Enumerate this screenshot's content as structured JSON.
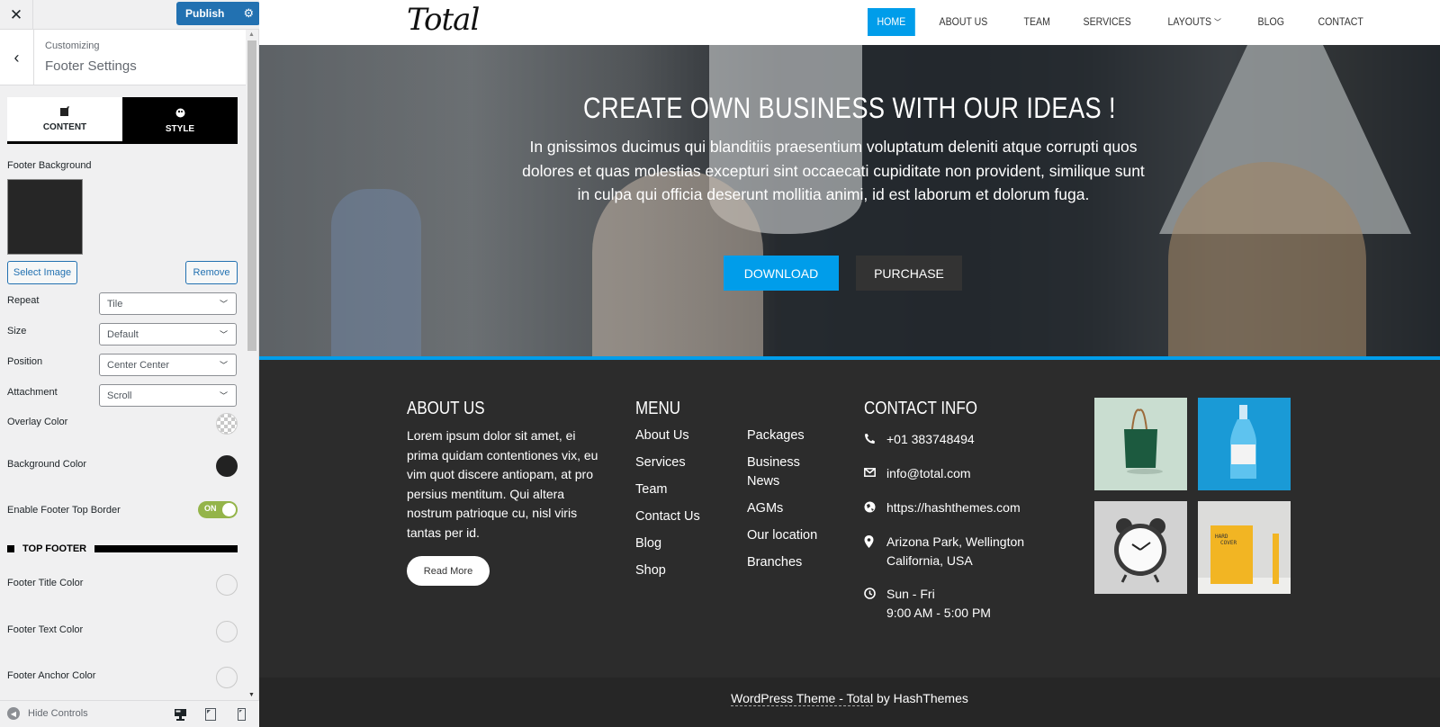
{
  "customizer": {
    "close_icon": "close-icon",
    "publish_label": "Publish",
    "settings_icon": "gear-icon",
    "back_icon": "chevron-left-icon",
    "breadcrumb_label": "Customizing",
    "section_title": "Footer Settings",
    "tabs": [
      {
        "label": "CONTENT",
        "icon": "edit-icon",
        "active": false
      },
      {
        "label": "STYLE",
        "icon": "palette-icon",
        "active": true
      }
    ],
    "footer_background": {
      "label": "Footer Background",
      "preview_color": "#262626",
      "select_image_label": "Select Image",
      "remove_label": "Remove"
    },
    "selects": [
      {
        "label": "Repeat",
        "value": "Tile"
      },
      {
        "label": "Size",
        "value": "Default"
      },
      {
        "label": "Position",
        "value": "Center Center"
      },
      {
        "label": "Attachment",
        "value": "Scroll"
      }
    ],
    "overlay_color": {
      "label": "Overlay Color",
      "value": "transparent"
    },
    "background_color": {
      "label": "Background Color",
      "value": "#222222"
    },
    "top_border_toggle": {
      "label": "Enable Footer Top Border",
      "state_label": "ON",
      "on": true
    },
    "group_heading": "TOP FOOTER",
    "color_controls": [
      {
        "label": "Footer Title Color",
        "value": ""
      },
      {
        "label": "Footer Text Color",
        "value": ""
      },
      {
        "label": "Footer Anchor Color",
        "value": ""
      }
    ],
    "hide_controls_label": "Hide Controls",
    "devices": [
      "desktop-icon",
      "tablet-icon",
      "mobile-icon"
    ]
  },
  "site": {
    "logo": "Total",
    "nav": [
      {
        "label": "HOME",
        "active": true
      },
      {
        "label": "ABOUT US"
      },
      {
        "label": "TEAM"
      },
      {
        "label": "SERVICES"
      },
      {
        "label": "LAYOUTS",
        "has_dropdown": true
      },
      {
        "label": "BLOG"
      },
      {
        "label": "CONTACT"
      }
    ],
    "accent_color": "#009dea",
    "hero": {
      "title": "CREATE OWN BUSINESS WITH OUR IDEAS !",
      "text": "In gnissimos ducimus qui blanditiis praesentium voluptatum deleniti atque corrupti quos dolores et quas molestias excepturi sint occaecati cupiditate non provident, similique sunt in culpa qui officia deserunt mollitia animi, id est laborum et dolorum fuga.",
      "download_label": "DOWNLOAD",
      "purchase_label": "PURCHASE"
    },
    "footer": {
      "about": {
        "title": "ABOUT US",
        "text": "Lorem ipsum dolor sit amet, ei prima quidam contentiones vix, eu vim quot discere antiopam, at pro persius mentitum. Qui altera nostrum patrioque cu, nisl viris tantas per id.",
        "read_more_label": "Read More"
      },
      "menu": {
        "title": "MENU",
        "col1": [
          "About Us",
          "Services",
          "Team",
          "Contact Us",
          "Blog",
          "Shop"
        ],
        "col2": [
          "Packages",
          "Business News",
          "AGMs",
          "Our location",
          "Branches"
        ]
      },
      "contact": {
        "title": "CONTACT INFO",
        "phone": "+01 383748494",
        "email": "info@total.com",
        "website": "https://hashthemes.com",
        "address_line1": "Arizona Park, Wellington",
        "address_line2": "California, USA",
        "hours_line1": "Sun - Fri",
        "hours_line2": "9:00 AM - 5:00 PM"
      },
      "gallery": [
        {
          "name": "green-shopping-bag",
          "bg": "#c9ddd0"
        },
        {
          "name": "glass-bottle",
          "bg": "#1a9ad6"
        },
        {
          "name": "alarm-clock",
          "bg": "#d2d2d2"
        },
        {
          "name": "hardcover-book",
          "bg": "#dcdcda"
        }
      ],
      "copyright_link": "WordPress Theme - Total",
      "copyright_suffix": " by HashThemes"
    }
  }
}
